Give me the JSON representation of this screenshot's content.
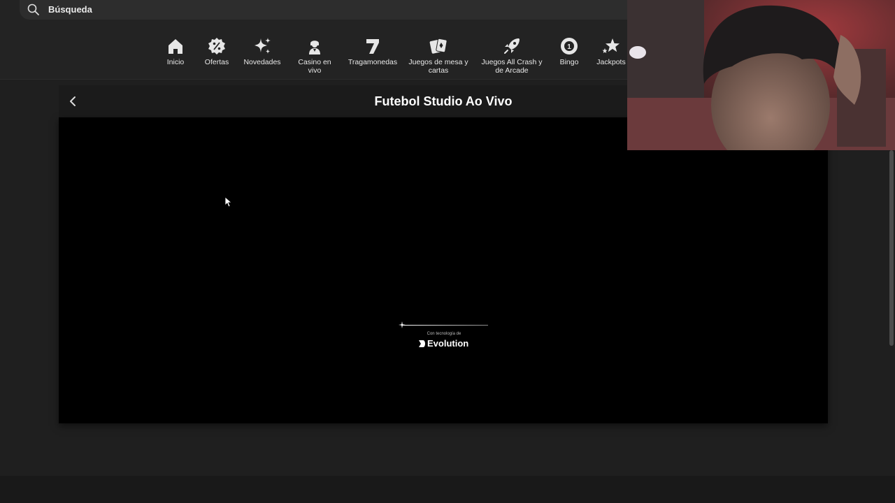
{
  "search": {
    "placeholder": "Búsqueda",
    "icon": "search-icon"
  },
  "nav": {
    "items": [
      {
        "label": "Inicio",
        "icon": "home-icon"
      },
      {
        "label": "Ofertas",
        "icon": "percent-badge-icon"
      },
      {
        "label": "Novedades",
        "icon": "sparkles-icon"
      },
      {
        "label": "Casino en\nvivo",
        "icon": "dealer-icon"
      },
      {
        "label": "Tragamonedas",
        "icon": "seven-icon"
      },
      {
        "label": "Juegos de mesa y\ncartas",
        "icon": "cards-icon"
      },
      {
        "label": "Juegos All Crash y\nde Arcade",
        "icon": "rocket-icon"
      },
      {
        "label": "Bingo",
        "icon": "bingo-ball-icon"
      },
      {
        "label": "Jackpots",
        "icon": "stars-icon"
      }
    ]
  },
  "game": {
    "title": "Futebol Studio Ao Vivo",
    "back_icon": "chevron-left-icon",
    "loader": {
      "powered_by": "Con tecnología de",
      "brand": "Evolution"
    }
  },
  "colors": {
    "background": "#1f1f1f",
    "topbar": "#232323",
    "stage": "#000000",
    "text": "#ffffff"
  }
}
